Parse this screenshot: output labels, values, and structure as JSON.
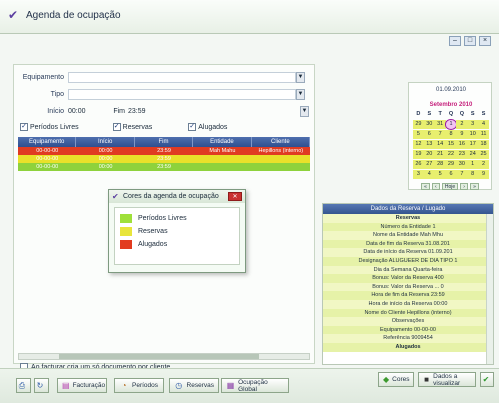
{
  "window": {
    "title": "Agenda de ocupação"
  },
  "filters": {
    "equipment_label": "Equipamento",
    "type_label": "Tipo",
    "start_label": "Início",
    "start_value": "00:00",
    "end_label": "Fim",
    "end_value": "23:59"
  },
  "checkboxes": [
    {
      "label": "Períodos Livres",
      "checked": true
    },
    {
      "label": "Reservas",
      "checked": true
    },
    {
      "label": "Alugados",
      "checked": true
    }
  ],
  "grid": {
    "columns": [
      "Equipamento",
      "Início",
      "Fim",
      "Entidade",
      "Cliente"
    ],
    "rows": [
      {
        "color": "#e03b22",
        "cells": [
          "00-00-00",
          "00:00",
          "23:59",
          "Mah Mahu",
          "Hepillons (interno)"
        ]
      },
      {
        "color": "#e9e12a",
        "cells": [
          "00-00-00",
          "00:00",
          "23:59",
          "",
          ""
        ]
      },
      {
        "color": "#8ed23c",
        "cells": [
          "00-00-00",
          "00:00",
          "23:59",
          "",
          ""
        ]
      }
    ]
  },
  "legend_popup": {
    "title": "Cores da agenda de ocupação",
    "items": [
      {
        "label": "Períodos Livres",
        "color": "#9fe03a"
      },
      {
        "label": "Reservas",
        "color": "#e8e53b"
      },
      {
        "label": "Alugados",
        "color": "#e23b1f"
      }
    ]
  },
  "note": {
    "label": "Ao facturar cria um só documento por cliente"
  },
  "calendar": {
    "selected_date": "01.09.2010",
    "month_label": "Setembro 2010",
    "weekdays": [
      "D",
      "S",
      "T",
      "Q",
      "Q",
      "S",
      "S"
    ],
    "days": [
      "29",
      "30",
      "31",
      "1",
      "2",
      "3",
      "4",
      "5",
      "6",
      "7",
      "8",
      "9",
      "10",
      "11",
      "12",
      "13",
      "14",
      "15",
      "16",
      "17",
      "18",
      "19",
      "20",
      "21",
      "22",
      "23",
      "24",
      "25",
      "26",
      "27",
      "28",
      "29",
      "30",
      "1",
      "2",
      "3",
      "4",
      "5",
      "6",
      "7",
      "8",
      "9"
    ],
    "today_label": "Hoje"
  },
  "details": {
    "header": "Dados da Reserva / Lugado",
    "rows": [
      {
        "text": "Reservas",
        "section": true
      },
      {
        "text": "Número da Entidade 1",
        "section": false
      },
      {
        "text": "Nome da Entidade Mah Mhu",
        "section": false
      },
      {
        "text": "Data de fim da Reserva 31.08.201",
        "section": false
      },
      {
        "text": "Data de início da Reserva 01.09.201",
        "section": false
      },
      {
        "text": "Designação ALUGUEER DE DIA TIPO 1",
        "section": false
      },
      {
        "text": "Dia da Semana Quarta-feira",
        "section": false
      },
      {
        "text": "Bonus: Valor da Reserva 400",
        "section": false
      },
      {
        "text": "Bonus: Valor da Reserva ... 0",
        "section": false
      },
      {
        "text": "Hora de fim da Reserva 23:59",
        "section": false
      },
      {
        "text": "Hora de início da Reserva 00:00",
        "section": false
      },
      {
        "text": "Nome do Cliente Hepillons (interno)",
        "section": false
      },
      {
        "text": "Observações",
        "section": false
      },
      {
        "text": "Equipamento 00-00-00",
        "section": false
      },
      {
        "text": "Referência 9009454",
        "section": false
      },
      {
        "text": "Alugados",
        "section": true
      }
    ]
  },
  "bottom_bar": {
    "facturacao": "Facturação",
    "periodos": "Períodos",
    "reservas": "Reservas",
    "ocupacao": "Ocupação Global",
    "cores": "Cores",
    "dados": "Dados a visualizar"
  }
}
